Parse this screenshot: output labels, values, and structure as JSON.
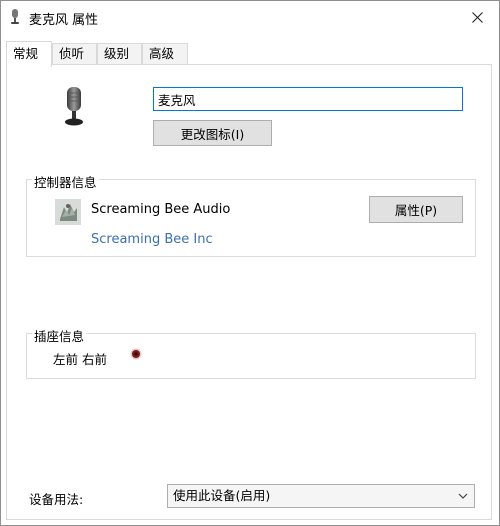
{
  "window": {
    "title": "麦克风 属性",
    "close_icon": "close-icon"
  },
  "tabs": [
    {
      "label": "常规",
      "active": true
    },
    {
      "label": "侦听",
      "active": false
    },
    {
      "label": "级别",
      "active": false
    },
    {
      "label": "高级",
      "active": false
    }
  ],
  "device": {
    "icon": "microphone-icon",
    "name_value": "麦克风",
    "change_icon_button": "更改图标(I)"
  },
  "controller": {
    "group_title": "控制器信息",
    "icon": "audio-driver-icon",
    "name": "Screaming Bee Audio",
    "vendor": "Screaming Bee Inc",
    "properties_button": "属性(P)"
  },
  "jack": {
    "group_title": "插座信息",
    "location_text": "左前 右前",
    "color": "#7b1a1a"
  },
  "usage": {
    "label": "设备用法:",
    "selected": "使用此设备(启用)"
  }
}
